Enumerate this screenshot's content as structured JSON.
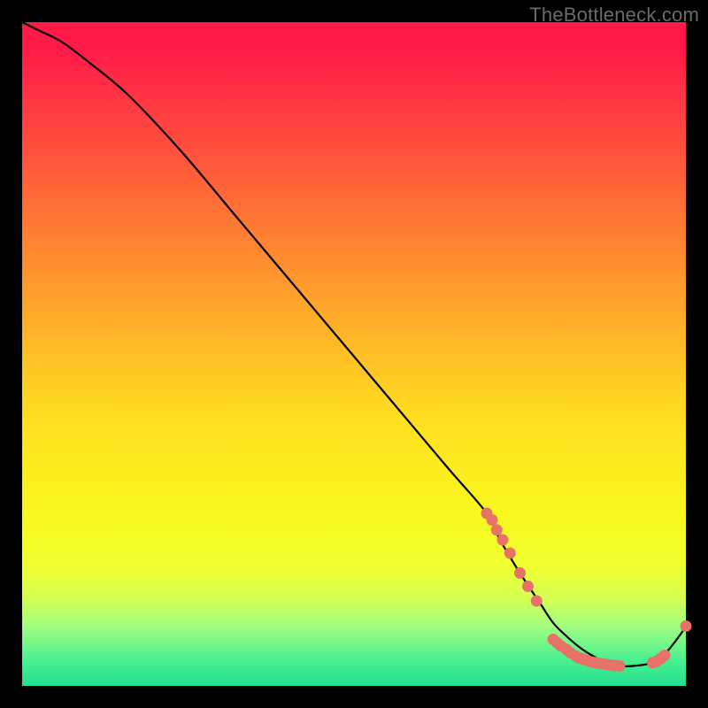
{
  "watermark": "TheBottleneck.com",
  "colors": {
    "background": "#000000",
    "curve_stroke": "#000000",
    "marker_fill": "#e77268",
    "watermark_text": "#6a6a6a"
  },
  "chart_data": {
    "type": "line",
    "title": "",
    "xlabel": "",
    "ylabel": "",
    "xlim": [
      0,
      100
    ],
    "ylim": [
      0,
      100
    ],
    "grid": false,
    "legend": false,
    "series": [
      {
        "name": "bottleneck-curve",
        "x": [
          0,
          2,
          6,
          10,
          16,
          24,
          32,
          40,
          48,
          56,
          64,
          70,
          72,
          75,
          78,
          80,
          82,
          84,
          86,
          88,
          90,
          92,
          95,
          97,
          99,
          100
        ],
        "y": [
          100,
          99,
          97,
          94,
          89,
          80.5,
          71,
          61.5,
          52,
          42.5,
          33,
          26,
          22,
          17,
          12.5,
          9.5,
          7.5,
          5.8,
          4.5,
          3.5,
          3,
          3,
          3.5,
          5,
          7.5,
          9
        ]
      }
    ],
    "markers": [
      {
        "x": 70.0,
        "y": 26.0
      },
      {
        "x": 70.8,
        "y": 25.0
      },
      {
        "x": 71.5,
        "y": 23.5
      },
      {
        "x": 72.4,
        "y": 22.0
      },
      {
        "x": 73.5,
        "y": 20.0
      },
      {
        "x": 75.0,
        "y": 17.0
      },
      {
        "x": 76.2,
        "y": 15.0
      },
      {
        "x": 77.5,
        "y": 12.8
      },
      {
        "x": 80.0,
        "y": 7.0
      },
      {
        "x": 80.6,
        "y": 6.5
      },
      {
        "x": 81.2,
        "y": 6.0
      },
      {
        "x": 82.0,
        "y": 5.5
      },
      {
        "x": 82.6,
        "y": 5.0
      },
      {
        "x": 83.4,
        "y": 4.5
      },
      {
        "x": 84.0,
        "y": 4.2
      },
      {
        "x": 84.6,
        "y": 4.0
      },
      {
        "x": 85.2,
        "y": 3.8
      },
      {
        "x": 85.8,
        "y": 3.6
      },
      {
        "x": 86.4,
        "y": 3.5
      },
      {
        "x": 87.0,
        "y": 3.4
      },
      {
        "x": 87.6,
        "y": 3.3
      },
      {
        "x": 88.2,
        "y": 3.2
      },
      {
        "x": 88.8,
        "y": 3.1
      },
      {
        "x": 89.4,
        "y": 3.05
      },
      {
        "x": 90.0,
        "y": 3.0
      },
      {
        "x": 95.0,
        "y": 3.5
      },
      {
        "x": 95.6,
        "y": 3.7
      },
      {
        "x": 96.2,
        "y": 4.1
      },
      {
        "x": 96.8,
        "y": 4.6
      },
      {
        "x": 100.0,
        "y": 9.0
      }
    ]
  }
}
